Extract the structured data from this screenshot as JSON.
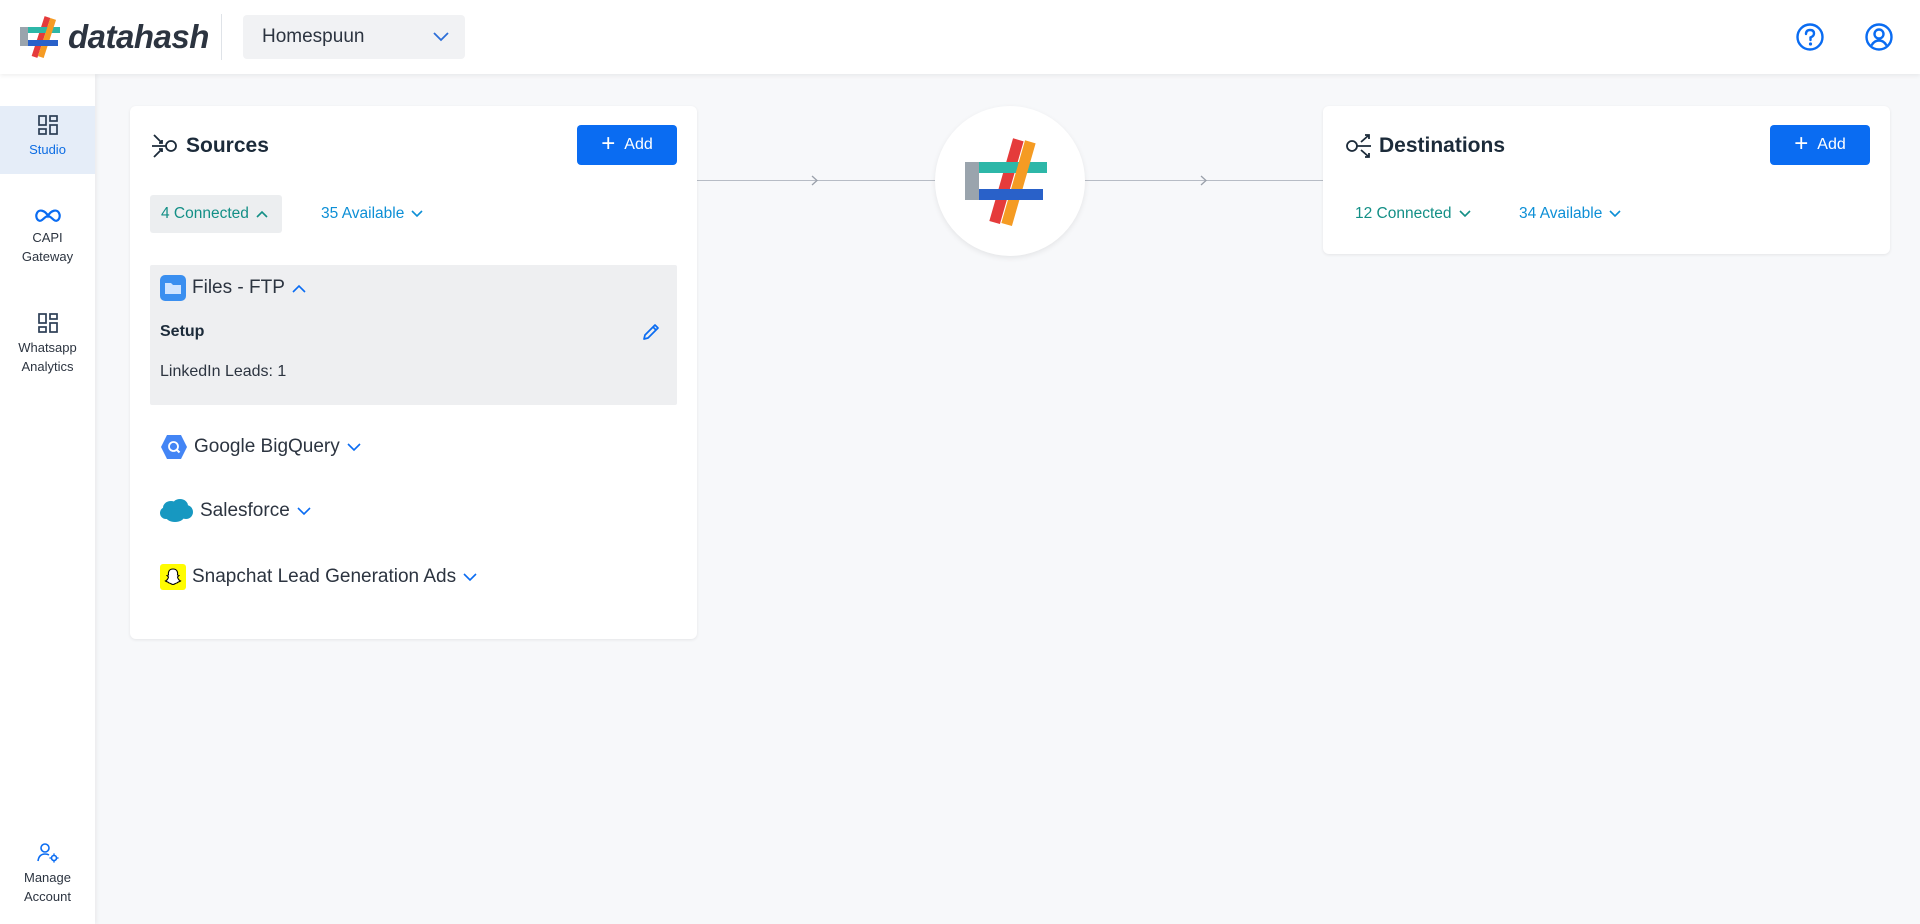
{
  "header": {
    "logo_text": "datahash",
    "org_selector": "Homespuun",
    "icons": [
      "help-circle-icon",
      "user-account-icon"
    ]
  },
  "sidebar": {
    "items": [
      {
        "label": "Studio",
        "icon": "dashboard-grid-icon",
        "active": true
      },
      {
        "label": "CAPI Gateway",
        "icon": "meta-infinity-icon",
        "active": false
      },
      {
        "label": "Whatsapp Analytics",
        "icon": "dashboard-grid-icon",
        "active": false
      }
    ],
    "footer": {
      "label": "Manage Account",
      "icon": "user-gear-icon"
    }
  },
  "sources": {
    "title": "Sources",
    "add_label": "Add",
    "connected": "4 Connected",
    "available": "35 Available",
    "items": [
      {
        "name": "Files - FTP",
        "icon": "folder-icon",
        "expanded": true
      },
      {
        "name": "Google BigQuery",
        "icon": "bigquery-icon",
        "expanded": false
      },
      {
        "name": "Salesforce",
        "icon": "salesforce-icon",
        "expanded": false
      },
      {
        "name": "Snapchat Lead Generation Ads",
        "icon": "snapchat-icon",
        "expanded": false
      }
    ],
    "setup_title": "Setup",
    "setup_detail": "LinkedIn Leads: 1"
  },
  "destinations": {
    "title": "Destinations",
    "add_label": "Add",
    "connected": "12 Connected",
    "available": "34 Available"
  },
  "colors": {
    "primary": "#0a6cf2",
    "teal": "#138f86",
    "available_blue": "#0d8fd6",
    "active_nav_bg": "#e5edf8"
  }
}
